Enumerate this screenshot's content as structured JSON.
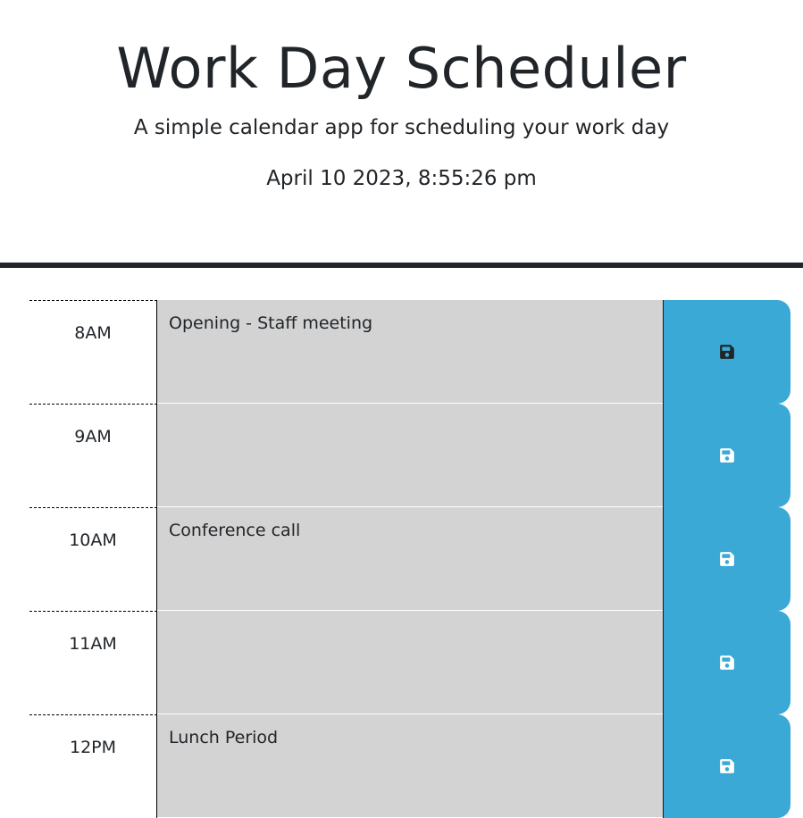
{
  "header": {
    "title": "Work Day Scheduler",
    "subtitle": "A simple calendar app for scheduling your work day",
    "current_datetime": "April 10 2023, 8:55:26 pm"
  },
  "schedule": {
    "rows": [
      {
        "hour": "8AM",
        "description": "Opening - Staff meeting",
        "save_icon": "floppy-disk-icon",
        "icon_color": "#212529"
      },
      {
        "hour": "9AM",
        "description": "",
        "save_icon": "floppy-disk-icon",
        "icon_color": "#ffffff"
      },
      {
        "hour": "10AM",
        "description": "Conference call",
        "save_icon": "floppy-disk-icon",
        "icon_color": "#ffffff"
      },
      {
        "hour": "11AM",
        "description": "",
        "save_icon": "floppy-disk-icon",
        "icon_color": "#ffffff"
      },
      {
        "hour": "12PM",
        "description": "Lunch Period",
        "save_icon": "floppy-disk-icon",
        "icon_color": "#ffffff"
      }
    ]
  },
  "colors": {
    "save_button": "#3aa9d6",
    "description_bg": "#d3d3d3",
    "header_border": "#212529"
  }
}
